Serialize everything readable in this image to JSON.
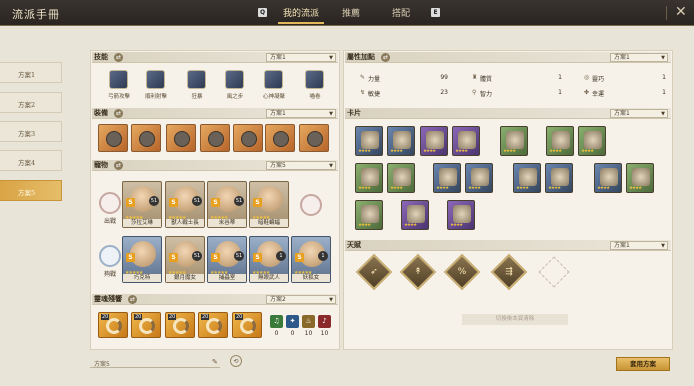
{
  "app_title": "流派手冊",
  "topbar": {
    "key_left": "Q",
    "key_right": "E",
    "tabs": [
      {
        "label": "我的流派",
        "active": true
      },
      {
        "label": "推薦",
        "active": false
      },
      {
        "label": "搭配",
        "active": false
      }
    ]
  },
  "sidebar": {
    "items": [
      {
        "label": "方案1",
        "active": false
      },
      {
        "label": "方案2",
        "active": false
      },
      {
        "label": "方案3",
        "active": false
      },
      {
        "label": "方案4",
        "active": false
      },
      {
        "label": "方案5",
        "active": true
      }
    ]
  },
  "skills": {
    "title": "技能",
    "plan": "方案1",
    "items": [
      {
        "label": "弓箭攻擊",
        "icon": "bow-icon"
      },
      {
        "label": "順利射擊",
        "icon": "volley-icon"
      },
      {
        "label": "狂暴",
        "icon": "berserk-icon"
      },
      {
        "label": "風之步",
        "icon": "wind-step-icon"
      },
      {
        "label": "心神凝聚",
        "icon": "focus-icon"
      },
      {
        "label": "喵卷",
        "icon": "cat-scroll-icon"
      }
    ]
  },
  "equipment": {
    "title": "裝備",
    "plan": "方案1",
    "items": [
      "bow-equip-icon",
      "quiver-equip-icon",
      "armor-equip-icon",
      "glove-equip-icon",
      "pants-equip-icon",
      "boots-equip-icon",
      "necklace-equip-icon"
    ]
  },
  "pets": {
    "title": "寵物",
    "plan": "方案5",
    "rows": [
      {
        "label": "出戰",
        "items": [
          {
            "name": "莎拉艾琳",
            "level": "51"
          },
          {
            "name": "獸人戰士長",
            "level": "51"
          },
          {
            "name": "米谷蒂",
            "level": "51"
          },
          {
            "name": "暗鞋蝙蝠",
            "level": ""
          }
        ]
      },
      {
        "label": "夠戰",
        "items": [
          {
            "name": "巧克特",
            "level": ""
          },
          {
            "name": "銀月魔女",
            "level": "51"
          },
          {
            "name": "捕蟲室",
            "level": "51"
          },
          {
            "name": "無眼武人",
            "level": "1"
          },
          {
            "name": "妖狐女",
            "level": "1"
          }
        ]
      }
    ]
  },
  "souls": {
    "title": "靈魂殘響",
    "plan": "方案2",
    "levels": [
      "20",
      "20",
      "20",
      "20",
      "20"
    ],
    "runes": [
      {
        "value": "0",
        "color": "#3a7a3a",
        "icon": "note-icon"
      },
      {
        "value": "0",
        "color": "#2e5a8a",
        "icon": "wing-icon"
      },
      {
        "value": "10",
        "color": "#8a6a2a",
        "icon": "flame-icon"
      },
      {
        "value": "10",
        "color": "#8a2a2a",
        "icon": "scroll-icon"
      }
    ]
  },
  "attributes": {
    "title": "屬性加點",
    "plan": "方案1",
    "items": [
      {
        "name": "力量",
        "value": "99"
      },
      {
        "name": "體質",
        "value": "1"
      },
      {
        "name": "靈巧",
        "value": "1"
      },
      {
        "name": "敏捷",
        "value": "23"
      },
      {
        "name": "智力",
        "value": "1"
      },
      {
        "name": "幸運",
        "value": "1"
      }
    ]
  },
  "cards": {
    "title": "卡片",
    "plan": "方案1"
  },
  "talent": {
    "title": "天賦",
    "plan": "方案1",
    "clear_label": "切換後本頁清除"
  },
  "footer": {
    "plan_name": "方案5",
    "apply_label": "套用方案"
  }
}
